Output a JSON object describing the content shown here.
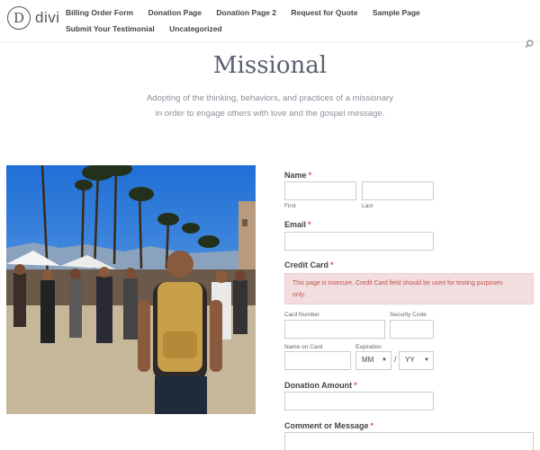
{
  "logo": {
    "letter": "D",
    "text": "divi"
  },
  "nav": [
    "Billing Order Form",
    "Donation Page",
    "Donation Page 2",
    "Request for Quote",
    "Sample Page",
    "Submit Your Testimonial",
    "Uncategorized"
  ],
  "page": {
    "title": "Missional",
    "subtitle_line1": "Adopting of the thinking, behaviors, and practices of a missionary",
    "subtitle_line2": "in order to engage others with love and the gospel message."
  },
  "form": {
    "name_label": "Name",
    "required_mark": "*",
    "first_label": "First",
    "last_label": "Last",
    "email_label": "Email",
    "cc_label": "Credit Card",
    "cc_alert_line1": "This page is insecure. Credit Card field should be used for testing purposes",
    "cc_alert_line2": "only.",
    "card_number_label": "Card Number",
    "security_code_label": "Security Code",
    "name_on_card_label": "Name on Card",
    "expiration_label": "Expiration",
    "month_value": "MM",
    "year_value": "YY",
    "slash": "/",
    "donation_label": "Donation Amount",
    "comment_label": "Comment or Message"
  },
  "colors": {
    "required": "#d9534f",
    "alert_bg": "#f2dede",
    "title": "#5a6170"
  }
}
